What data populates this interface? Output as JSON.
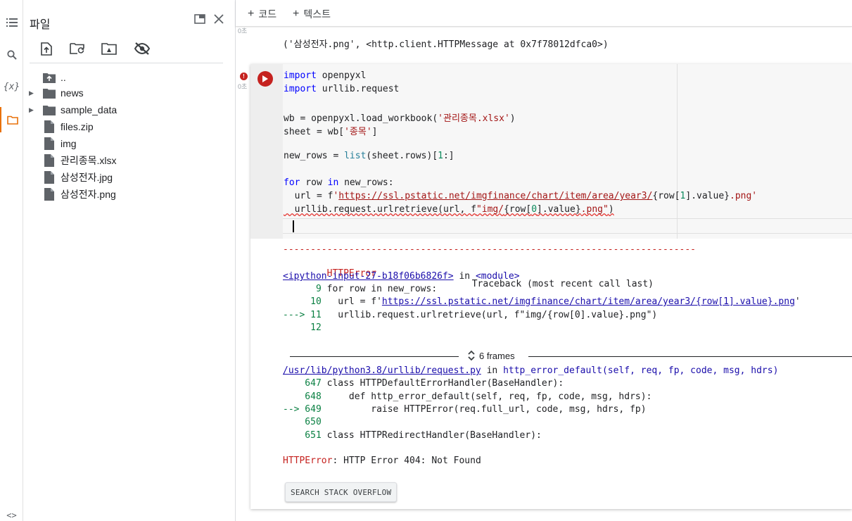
{
  "rail": {
    "items": [
      "table-of-contents-icon",
      "search-icon",
      "variables-icon",
      "folder-icon"
    ],
    "bottom_icon": "code-icon",
    "variables_label": "{x}",
    "bottom_label": "<>"
  },
  "files_panel": {
    "title": "파일",
    "toolbar": [
      "upload-icon",
      "refresh-icon",
      "mount-drive-icon",
      "hide-files-icon"
    ],
    "tree": [
      {
        "label": "..",
        "kind": "parent"
      },
      {
        "label": "news",
        "kind": "folder"
      },
      {
        "label": "sample_data",
        "kind": "folder"
      },
      {
        "label": "files.zip",
        "kind": "file"
      },
      {
        "label": "img",
        "kind": "file"
      },
      {
        "label": "관리종목.xlsx",
        "kind": "file"
      },
      {
        "label": "삼성전자.jpg",
        "kind": "file"
      },
      {
        "label": "삼성전자.png",
        "kind": "file"
      }
    ]
  },
  "topbar": {
    "add_code": "코드",
    "add_text": "텍스트"
  },
  "notebook": {
    "prev_exec": "0초",
    "prev_output": "('삼성전자.png', <http.client.HTTPMessage at 0x7f78012dfca0>)",
    "cell_exec": "0초",
    "code": {
      "l1_kw": "import",
      "l1_rest": " openpyxl",
      "l2_kw": "import",
      "l2_rest": " urllib.request",
      "l4_a": "wb = openpyxl.load_workbook(",
      "l4_str": "'관리종목.xlsx'",
      "l4_b": ")",
      "l5_a": "sheet = wb[",
      "l5_str": "'종목'",
      "l5_b": "]",
      "l7_a": "new_rows = ",
      "l7_bi": "list",
      "l7_b": "(sheet.rows)[",
      "l7_num": "1",
      "l7_c": ":]",
      "l9_kw": "for",
      "l9_a": " row ",
      "l9_kw2": "in",
      "l9_b": " new_rows:",
      "l10_a": "  url = f",
      "l10_q": "'",
      "l10_url": "https://ssl.pstatic.net/imgfinance/chart/item/area/year3/",
      "l10_b": "{row[",
      "l10_num": "1",
      "l10_c": "].value}",
      "l10_str": ".png'",
      "l11_a": "  urllib.request.urlretrieve(url, f",
      "l11_str": "\"img/",
      "l11_b": "{row[",
      "l11_num": "0",
      "l11_c": "].value}",
      "l11_str2": ".png\"",
      "l11_d": ")"
    },
    "traceback": {
      "dashes": "---------------------------------------------------------------------------",
      "err_name": "HTTPError",
      "trace_head": "Traceback (most recent call last)",
      "input_link": "<ipython-input-27-b18f06b6826f>",
      "in_word": " in ",
      "module": "<module>",
      "lines": [
        {
          "prefix": "      9",
          "text": " for row in new_rows:"
        },
        {
          "prefix": "     10",
          "text_a": "   url = f'",
          "text_url": "https://ssl.pstatic.net/imgfinance/chart/item/area/year3/{row[1].value}.png",
          "text_b": "'"
        },
        {
          "prefix": "---> 11",
          "text": "   urllib.request.urlretrieve(url, f\"img/{row[0].value}.png\")"
        },
        {
          "prefix": "     12",
          "text": ""
        }
      ],
      "frames_label": "6 frames",
      "lib_path": "/usr/lib/python3.8/urllib/request.py",
      "lib_func": "http_error_default(self, req, fp, code, msg, hdrs)",
      "lib_lines": [
        {
          "prefix": "    647",
          "text": " class HTTPDefaultErrorHandler(BaseHandler):"
        },
        {
          "prefix": "    648",
          "text": "     def http_error_default(self, req, fp, code, msg, hdrs):"
        },
        {
          "prefix": "--> 649",
          "text": "         raise HTTPError(req.full_url, code, msg, hdrs, fp)"
        },
        {
          "prefix": "    650",
          "text": ""
        },
        {
          "prefix": "    651",
          "text": " class HTTPRedirectHandler(BaseHandler):"
        }
      ],
      "final_err": "HTTPError",
      "final_msg": ": HTTP Error 404: Not Found"
    },
    "so_button": "SEARCH STACK OVERFLOW"
  },
  "colors": {
    "accent": "#e8710a",
    "error": "#c5221f",
    "link": "#1a0dab",
    "green": "#0b8043"
  }
}
